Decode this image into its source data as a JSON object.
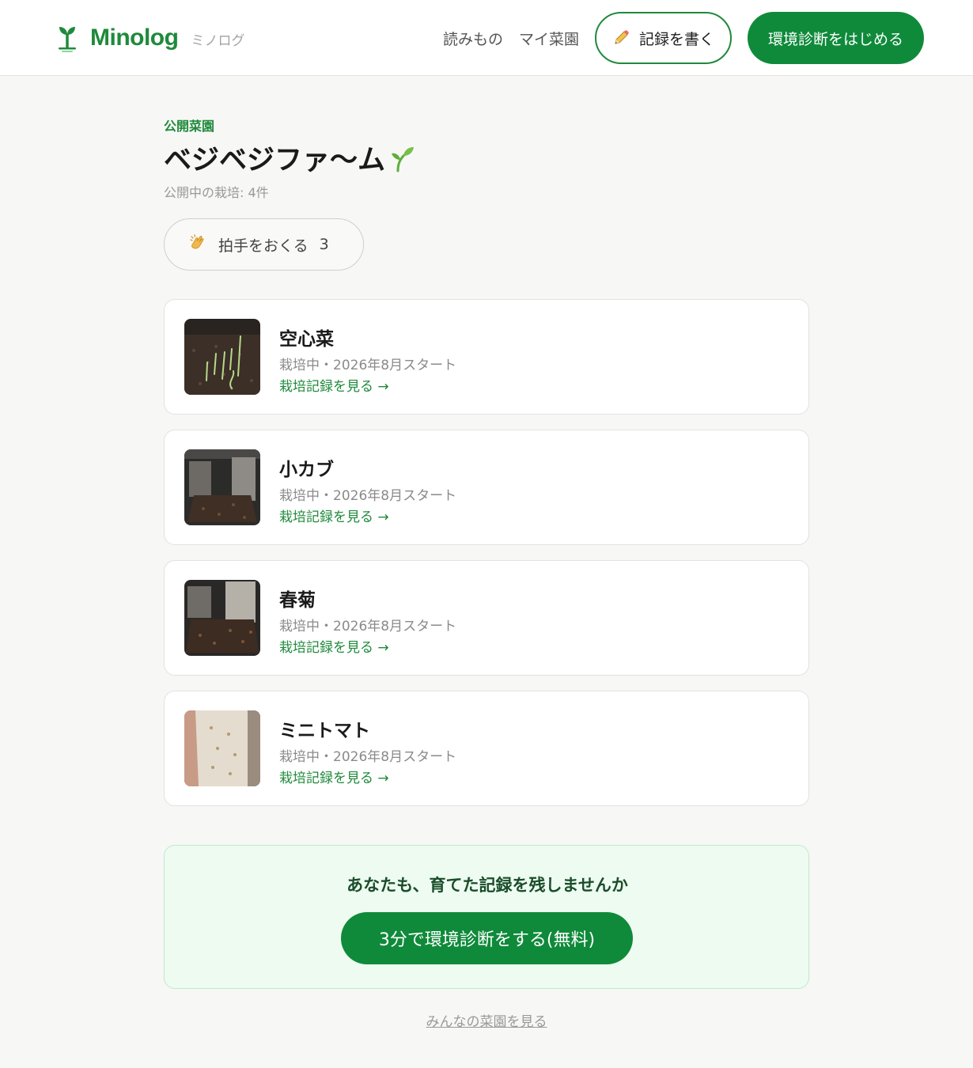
{
  "header": {
    "logo_text": "Minolog",
    "logo_sub": "ミノログ",
    "nav": [
      {
        "label": "読みもの"
      },
      {
        "label": "マイ菜園"
      }
    ],
    "write_button": "記録を書く",
    "diagnose_button": "環境診断をはじめる"
  },
  "garden": {
    "eyebrow": "公開菜園",
    "title": "ベジベジファ〜ム",
    "count_text": "公開中の栽培: 4件",
    "clap_label": "拍手をおくる",
    "clap_count": "3"
  },
  "crops": [
    {
      "name": "空心菜",
      "meta": "栽培中・2026年8月スタート",
      "link": "栽培記録を見る →"
    },
    {
      "name": "小カブ",
      "meta": "栽培中・2026年8月スタート",
      "link": "栽培記録を見る →"
    },
    {
      "name": "春菊",
      "meta": "栽培中・2026年8月スタート",
      "link": "栽培記録を見る →"
    },
    {
      "name": "ミニトマト",
      "meta": "栽培中・2026年8月スタート",
      "link": "栽培記録を見る →"
    }
  ],
  "cta": {
    "text": "あなたも、育てた記録を残しませんか",
    "button": "3分で環境診断をする(無料)"
  },
  "footer": {
    "all_gardens_link": "みんなの菜園を見る"
  },
  "colors": {
    "brand_green": "#0f8a3a",
    "cta_background": "#edfbf1"
  },
  "icons": [
    "sprout-logo-icon",
    "pencil-icon",
    "sprout-icon",
    "clap-icon"
  ]
}
